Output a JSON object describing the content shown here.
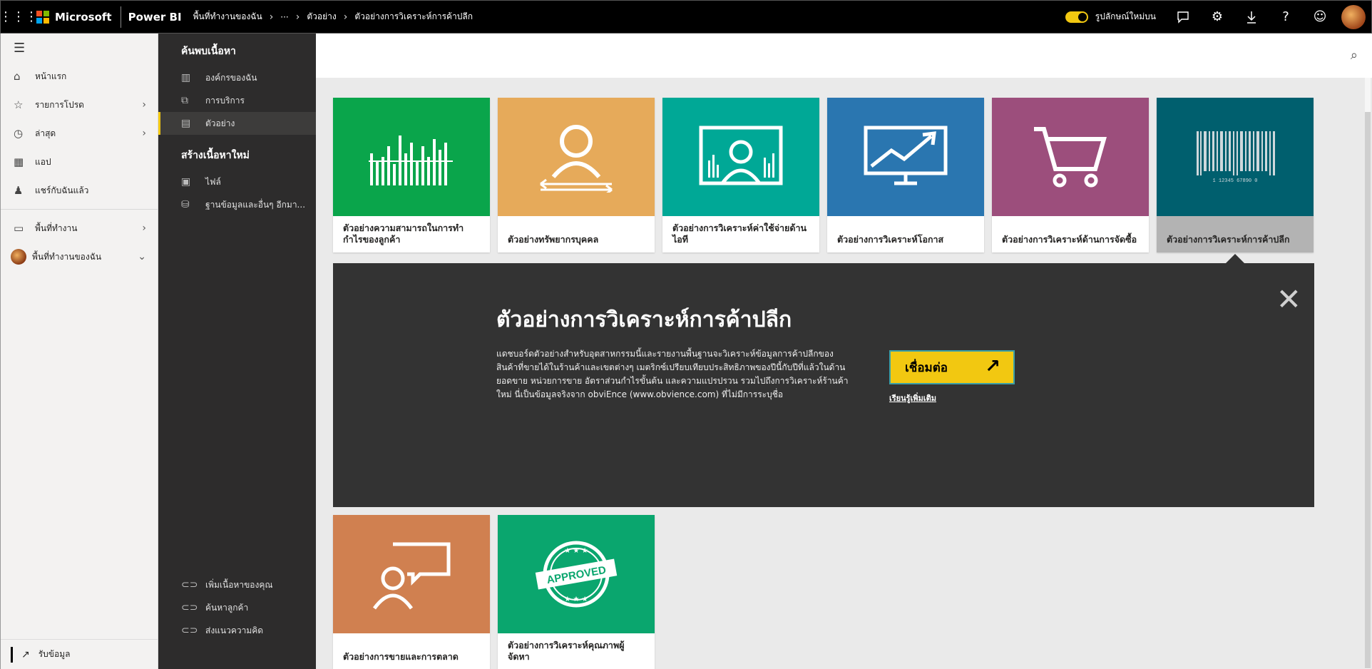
{
  "topbar": {
    "brand": "Microsoft",
    "product": "Power BI",
    "breadcrumb": [
      "พื้นที่ทำงานของฉัน",
      "···",
      "ตัวอย่าง",
      "ตัวอย่างการวิเคราะห์การค้าปลีก"
    ],
    "toggle_label": "รูปลักษณ์ใหม่บน",
    "icons": [
      "feedback-icon",
      "gear-icon",
      "download-icon",
      "help-icon",
      "smiley-icon"
    ]
  },
  "leftnav": {
    "items": [
      {
        "label": "หน้าแรก",
        "icon": "home-icon"
      },
      {
        "label": "รายการโปรด",
        "icon": "star-icon"
      },
      {
        "label": "ล่าสุด",
        "icon": "clock-icon"
      },
      {
        "label": "แอป",
        "icon": "apps-icon"
      },
      {
        "label": "แชร์กับฉันแล้ว",
        "icon": "shared-icon"
      }
    ],
    "workspaces": "พื้นที่ทำงาน",
    "my_workspace": "พื้นที่ทำงานของฉัน",
    "get_data": "รับข้อมูล"
  },
  "panel": {
    "discover_title": "ค้นพบเนื้อหา",
    "discover_items": [
      "องค์กรของฉัน",
      "การบริการ",
      "ตัวอย่าง"
    ],
    "create_title": "สร้างเนื้อหาใหม่",
    "create_items": [
      "ไฟล์",
      "ฐานข้อมูลและอื่นๆ อีกมา..."
    ],
    "bottom_items": [
      "เพิ่มเนื้อหาของคุณ",
      "ค้นหาลูกค้า",
      "ส่งแนวความคิด"
    ]
  },
  "tiles": [
    {
      "caption": "ตัวอย่างความสามารถในการทำกำไรของลูกค้า",
      "color": "#0aa54b"
    },
    {
      "caption": "ตัวอย่างทรัพยากรบุคคล",
      "color": "#e6aa5a"
    },
    {
      "caption": "ตัวอย่างการวิเคราะห์ค่าใช้จ่ายด้านไอที",
      "color": "#00a896"
    },
    {
      "caption": "ตัวอย่างการวิเคราะห์โอกาส",
      "color": "#2a76b0"
    },
    {
      "caption": "ตัวอย่างการวิเคราะห์ด้านการจัดซื้อ",
      "color": "#9c4e7c"
    },
    {
      "caption": "ตัวอย่างการวิเคราะห์การค้าปลีก",
      "color": "#005f6e"
    },
    {
      "caption": "ตัวอย่างการขายและการตลาด",
      "color": "#d08050"
    },
    {
      "caption": "ตัวอย่างการวิเคราะห์คุณภาพผู้จัดหา",
      "color": "#0aa66e"
    }
  ],
  "barcode_digits": "1 12345 67890 0",
  "approved_text": "APPROVED",
  "detail": {
    "title": "ตัวอย่างการวิเคราะห์การค้าปลีก",
    "description": "แดชบอร์ดตัวอย่างสำหรับอุตสาหกรรมนี้และรายงานพื้นฐานจะวิเคราะห์ข้อมูลการค้าปลีกของสินค้าที่ขายได้ในร้านค้าและเขตต่างๆ เมตริกซ์เปรียบเทียบประสิทธิภาพของปีนี้กับปีที่แล้วในด้านยอดขาย หน่วยการขาย อัตราส่วนกำไรขั้นต้น และความแปรปรวน รวมไปถึงการวิเคราะห์ร้านค้าใหม่ นี่เป็นข้อมูลจริงจาก obviEnce (www.obvience.com) ที่ไม่มีการระบุชื่อ",
    "connect_label": "เชื่อมต่อ",
    "learn_more": "เรียนรู้เพิ่มเติม"
  }
}
